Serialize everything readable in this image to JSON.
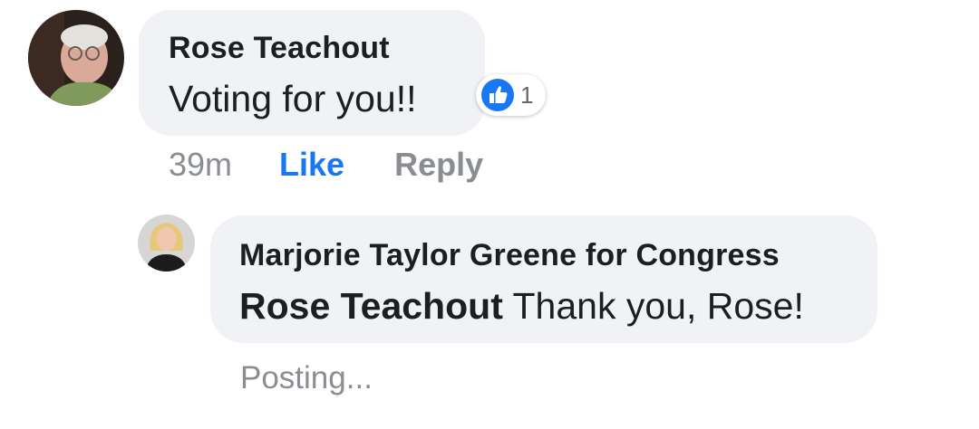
{
  "comment": {
    "author": "Rose Teachout",
    "text": "Voting for you!!",
    "reaction": {
      "icon": "thumbs-up-icon",
      "count": "1",
      "color": "#1877f2"
    },
    "actions": {
      "timestamp": "39m",
      "like_label": "Like",
      "reply_label": "Reply"
    }
  },
  "reply": {
    "author": "Marjorie Taylor Greene for Congress",
    "mention": "Rose Teachout",
    "text": "Thank you, Rose!",
    "status": "Posting..."
  },
  "colors": {
    "bubble": "#f0f2f5",
    "link_blue": "#1877f2",
    "muted": "#8a8d91",
    "text": "#1c1e21"
  }
}
